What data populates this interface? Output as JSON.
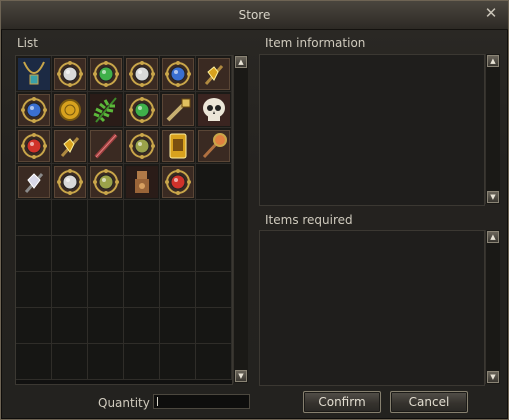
{
  "window": {
    "title": "Store",
    "close_symbol": "✕"
  },
  "list": {
    "label": "List",
    "items": [
      {
        "icon": "necklace-blue-icon"
      },
      {
        "icon": "gem-seal-white-icon"
      },
      {
        "icon": "gem-seal-green-icon"
      },
      {
        "icon": "gem-seal-white-icon"
      },
      {
        "icon": "gem-seal-blue-icon"
      },
      {
        "icon": "crystal-gold-icon"
      },
      {
        "icon": "gem-seal-blue-icon"
      },
      {
        "icon": "gold-coin-icon"
      },
      {
        "icon": "fern-leaf-icon"
      },
      {
        "icon": "gem-seal-green-icon"
      },
      {
        "icon": "key-scroll-icon"
      },
      {
        "icon": "skull-icon"
      },
      {
        "icon": "gem-seal-red-icon"
      },
      {
        "icon": "crystal-gold-icon"
      },
      {
        "icon": "wand-red-icon"
      },
      {
        "icon": "gem-seal-olive-icon"
      },
      {
        "icon": "tablet-gold-icon"
      },
      {
        "icon": "staff-orb-icon"
      },
      {
        "icon": "crystal-silver-icon"
      },
      {
        "icon": "gem-seal-white-icon"
      },
      {
        "icon": "gem-seal-olive-icon"
      },
      {
        "icon": "bronze-idol-icon"
      },
      {
        "icon": "gem-seal-red-icon"
      }
    ]
  },
  "item_information": {
    "label": "Item information"
  },
  "items_required": {
    "label": "Items required"
  },
  "quantity": {
    "label": "Quantity",
    "value": ""
  },
  "buttons": {
    "confirm": "Confirm",
    "cancel": "Cancel"
  },
  "scroll": {
    "up": "▲",
    "down": "▼"
  },
  "colors": {
    "blue": "#3a6fd0",
    "white": "#d9d9d9",
    "green": "#3fb04a",
    "red": "#d0322a",
    "olive": "#9aa24a",
    "gold": "#d8a21e",
    "frame": "#c9a64a"
  }
}
